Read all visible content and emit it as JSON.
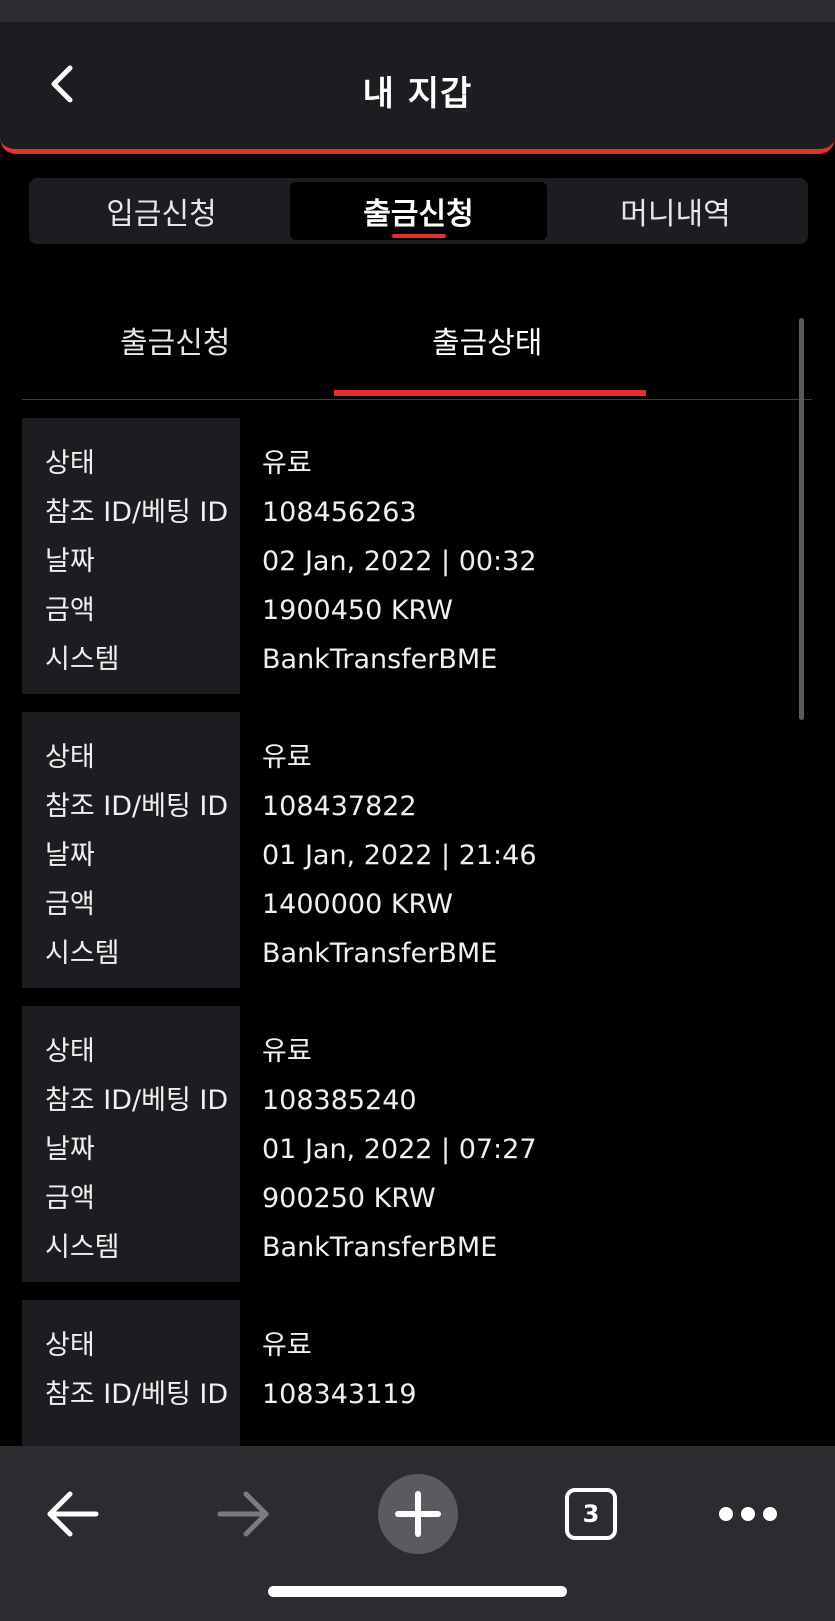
{
  "header": {
    "title": "내 지갑"
  },
  "main_tabs": [
    {
      "label": "입금신청",
      "active": false
    },
    {
      "label": "출금신청",
      "active": true
    },
    {
      "label": "머니내역",
      "active": false
    }
  ],
  "sub_tabs": [
    {
      "label": "출금신청",
      "active": false
    },
    {
      "label": "출금상태",
      "active": true
    }
  ],
  "record_labels": {
    "status": "상태",
    "ref_id": "참조 ID/베팅 ID",
    "date": "날짜",
    "amount": "금액",
    "system": "시스템"
  },
  "records": [
    {
      "status": "유료",
      "ref_id": "108456263",
      "date": "02 Jan, 2022 | 00:32",
      "amount": "1900450 KRW",
      "system": "BankTransferBME"
    },
    {
      "status": "유료",
      "ref_id": "108437822",
      "date": "01 Jan, 2022 | 21:46",
      "amount": "1400000 KRW",
      "system": "BankTransferBME"
    },
    {
      "status": "유료",
      "ref_id": "108385240",
      "date": "01 Jan, 2022 | 07:27",
      "amount": "900250 KRW",
      "system": "BankTransferBME"
    },
    {
      "status": "유료",
      "ref_id": "108343119"
    }
  ],
  "browser_toolbar": {
    "tab_count": "3",
    "icons": [
      "back-arrow-icon",
      "forward-arrow-icon",
      "plus-icon",
      "tabs-icon",
      "more-dots-icon"
    ]
  },
  "colors": {
    "accent": "#e0312d",
    "panel": "#1c1d20",
    "background": "#000000"
  }
}
